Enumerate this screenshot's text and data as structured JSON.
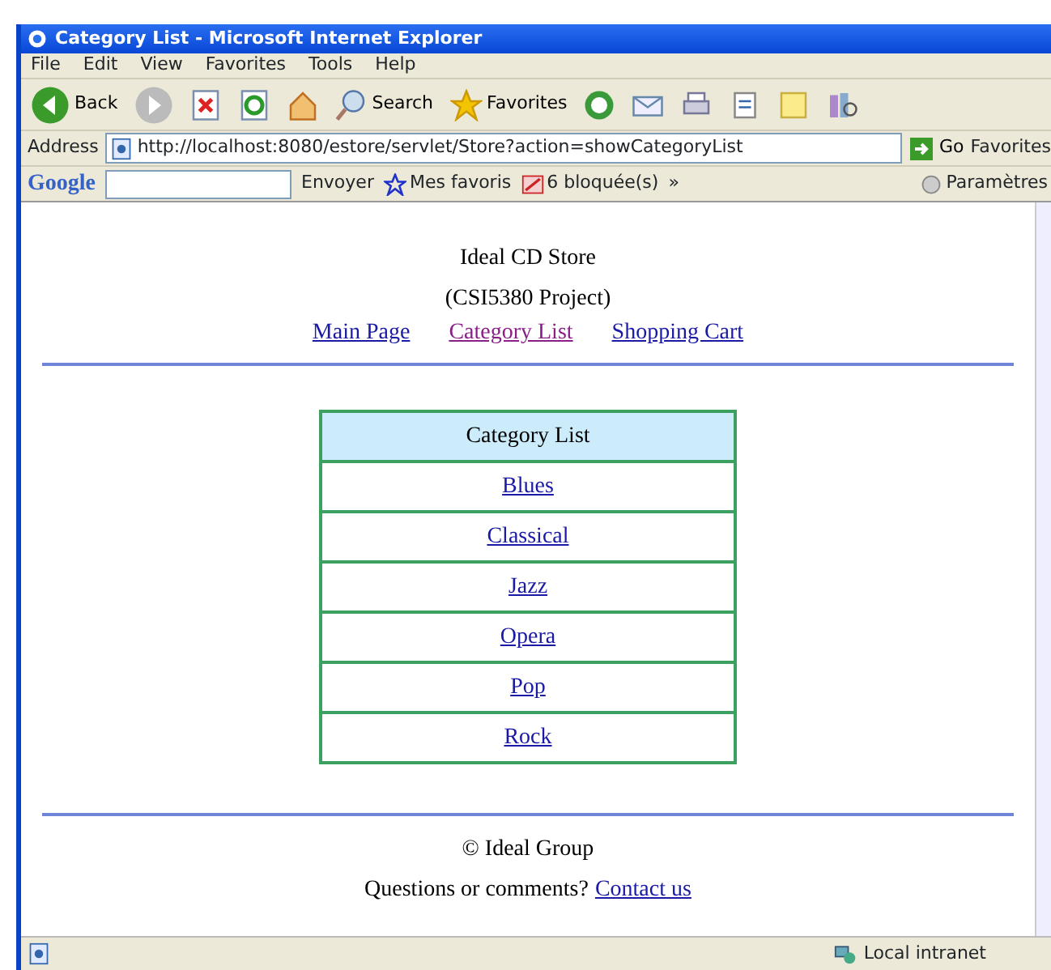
{
  "window": {
    "title": "Category List - Microsoft Internet Explorer"
  },
  "menu": [
    "File",
    "Edit",
    "View",
    "Favorites",
    "Tools",
    "Help"
  ],
  "toolbar": [
    {
      "kind": "back",
      "label": "Back"
    },
    {
      "kind": "forward"
    },
    {
      "kind": "stop"
    },
    {
      "kind": "refresh"
    },
    {
      "kind": "home"
    },
    {
      "kind": "search",
      "label": "Search"
    },
    {
      "kind": "favorites",
      "label": "Favorites"
    },
    {
      "kind": "history"
    },
    {
      "kind": "mail"
    },
    {
      "kind": "print"
    },
    {
      "kind": "edit"
    },
    {
      "kind": "note"
    },
    {
      "kind": "research"
    }
  ],
  "address": {
    "label": "Address",
    "value": "http://localhost:8080/estore/servlet/Store?action=showCategoryList",
    "go": "Go",
    "links": "Favorites"
  },
  "google_bar": {
    "logo": "Google",
    "send": "Envoyer",
    "favorites": "Mes favoris",
    "blocked": "6 bloquée(s)",
    "more": "»",
    "settings": "Paramètres"
  },
  "page": {
    "title": "Ideal CD Store",
    "subtitle": "(CSI5380 Project)",
    "nav": [
      {
        "label": "Main Page",
        "visited": false
      },
      {
        "label": "Category List",
        "visited": true
      },
      {
        "label": "Shopping Cart",
        "visited": false
      }
    ],
    "table": {
      "header": "Category List",
      "rows": [
        "Blues",
        "Classical",
        "Jazz",
        "Opera",
        "Pop",
        "Rock"
      ]
    },
    "footer": {
      "copyright": "© Ideal Group",
      "question": "Questions or comments?",
      "contact": "Contact us"
    }
  },
  "status_bar": {
    "zone": "Local intranet"
  }
}
